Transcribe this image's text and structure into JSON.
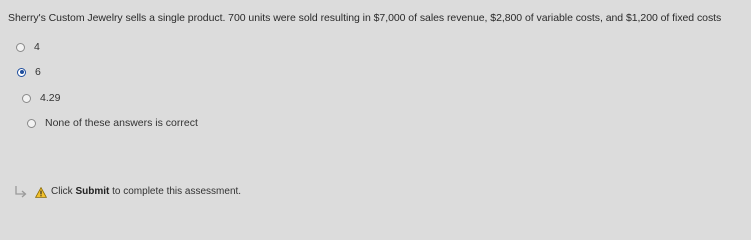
{
  "question": {
    "text": "Sherry's Custom Jewelry sells a single product. 700 units were sold resulting in $7,000 of sales revenue, $2,800 of variable costs, and $1,200 of fixed costs"
  },
  "options": [
    {
      "label": "4",
      "selected": false
    },
    {
      "label": "6",
      "selected": true
    },
    {
      "label": "4.29",
      "selected": false
    },
    {
      "label": "None of these answers is correct",
      "selected": false
    }
  ],
  "footer": {
    "prefix": "Click ",
    "bold": "Submit",
    "suffix": " to complete this assessment."
  },
  "colors": {
    "background": "#dcdcdc",
    "selected_radio": "#1f4e9e",
    "warning_fill": "#f2c12e"
  },
  "icons": {
    "footer_arrow": "arrow-right-icon",
    "footer_warning": "warning-icon"
  }
}
